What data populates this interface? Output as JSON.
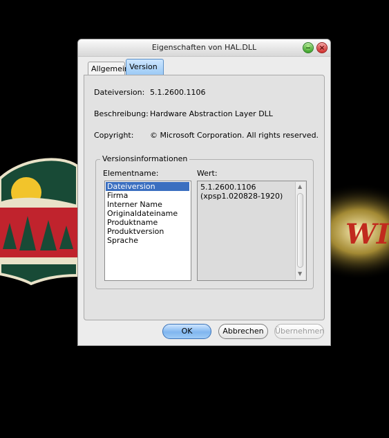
{
  "window": {
    "title": "Eigenschaften von HAL.DLL",
    "controls": [
      "minimize-icon",
      "close-icon"
    ]
  },
  "tabs": [
    {
      "label": "Allgemein",
      "active": false
    },
    {
      "label": "Version",
      "active": true
    }
  ],
  "properties": {
    "file_version": {
      "label": "Dateiversion:",
      "value": "5.1.2600.1106"
    },
    "description": {
      "label": "Beschreibung:",
      "value": "Hardware Abstraction Layer DLL"
    },
    "copyright": {
      "label": "Copyright:",
      "value": "© Microsoft Corporation. All rights reserved."
    }
  },
  "version_info": {
    "group_title": "Versionsinformationen",
    "element_header": "Elementname:",
    "value_header": "Wert:",
    "items": [
      "Dateiversion",
      "Firma",
      "Interner Name",
      "Originaldateiname",
      "Produktname",
      "Produktversion",
      "Sprache"
    ],
    "selected_item": "Dateiversion",
    "value_lines": [
      "5.1.2600.1106",
      "(xpsp1.020828-1920)"
    ]
  },
  "buttons": {
    "ok": "OK",
    "cancel": "Abbrechen",
    "apply": "Übernehmen"
  },
  "colors": {
    "selection": "#3b6fc0",
    "wallpaper_red": "#c0232d",
    "wallpaper_green": "#1d5b3a",
    "wallpaper_gold": "#f2c42b"
  }
}
